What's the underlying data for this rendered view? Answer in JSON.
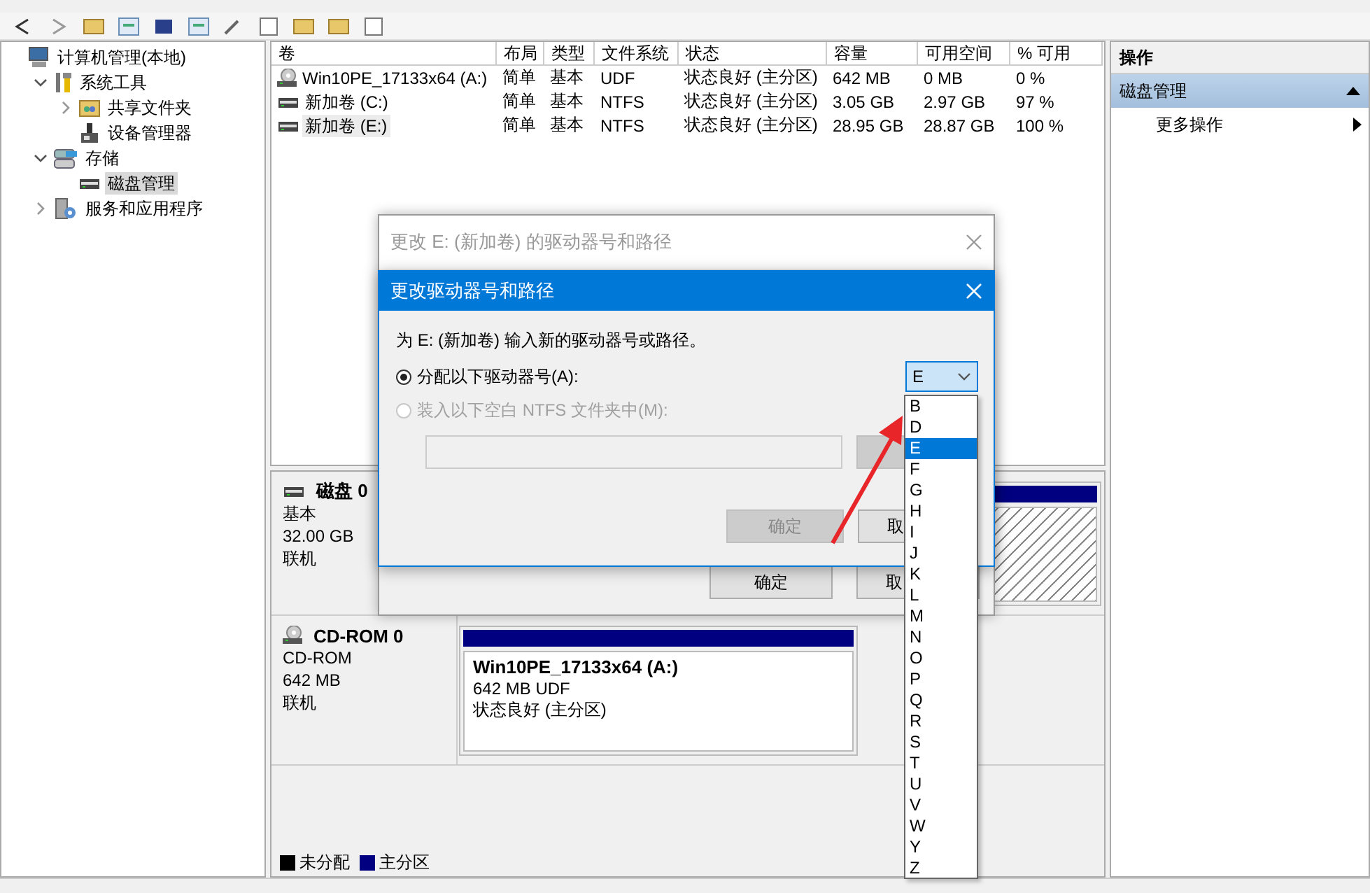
{
  "toolbar": [
    {
      "kind": "back"
    },
    {
      "kind": "forward"
    },
    {
      "kind": "folder"
    },
    {
      "kind": "grid"
    },
    {
      "kind": "box"
    },
    {
      "kind": "grid"
    },
    {
      "kind": "key"
    },
    {
      "kind": "page"
    },
    {
      "kind": "folder"
    },
    {
      "kind": "folder"
    },
    {
      "kind": "page"
    }
  ],
  "tree": [
    {
      "label": "计算机管理(本地)",
      "kind": "computer",
      "selected": false,
      "children": [
        {
          "label": "系统工具",
          "kind": "tools",
          "expanded": true,
          "selected": false,
          "children": [
            {
              "label": "共享文件夹",
              "kind": "share",
              "expanded": false,
              "selected": false
            },
            {
              "label": "设备管理器",
              "kind": "device",
              "selected": false
            }
          ]
        },
        {
          "label": "存储",
          "kind": "storage",
          "expanded": true,
          "selected": false,
          "children": [
            {
              "label": "磁盘管理",
              "kind": "disk",
              "selected": true
            }
          ]
        },
        {
          "label": "服务和应用程序",
          "kind": "services",
          "expanded": false,
          "selected": false
        }
      ]
    }
  ],
  "volumes": {
    "columns": [
      "卷",
      "布局",
      "类型",
      "文件系统",
      "状态",
      "容量",
      "可用空间",
      "% 可用"
    ],
    "rows": [
      {
        "kind": "cd",
        "selected": false,
        "cells": [
          "Win10PE_17133x64 (A:)",
          "简单",
          "基本",
          "UDF",
          "状态良好 (主分区)",
          "642 MB",
          "0 MB",
          "0 %"
        ]
      },
      {
        "kind": "disk",
        "selected": false,
        "cells": [
          "新加卷 (C:)",
          "简单",
          "基本",
          "NTFS",
          "状态良好 (主分区)",
          "3.05 GB",
          "2.97 GB",
          "97 %"
        ]
      },
      {
        "kind": "disk",
        "selected": true,
        "cells": [
          "新加卷 (E:)",
          "简单",
          "基本",
          "NTFS",
          "状态良好 (主分区)",
          "28.95 GB",
          "28.87 GB",
          "100 %"
        ]
      }
    ]
  },
  "disks": [
    {
      "kind": "disk",
      "name": "磁盘 0",
      "type": "基本",
      "size": "32.00 GB",
      "status": "联机",
      "partitions": [
        {
          "selected": true
        }
      ]
    },
    {
      "kind": "cd",
      "name": "CD-ROM 0",
      "type": "CD-ROM",
      "size": "642 MB",
      "status": "联机",
      "partitions": [
        {
          "selected": false,
          "name": "Win10PE_17133x64  (A:)",
          "detail": "642 MB UDF",
          "status": "状态良好 (主分区)"
        }
      ]
    }
  ],
  "legend": [
    {
      "label": "未分配",
      "color": "#000000"
    },
    {
      "label": "主分区",
      "color": "#000080"
    }
  ],
  "actions": {
    "title": "操作",
    "sections": [
      {
        "label": "磁盘管理",
        "expanded": true,
        "items": [
          {
            "label": "更多操作"
          }
        ]
      }
    ]
  },
  "back_dialog": {
    "title": "更改 E: (新加卷) 的驱动器号和路径",
    "buttons": [
      {
        "label": "确定",
        "disabled": false
      },
      {
        "label": "取",
        "disabled": false
      }
    ]
  },
  "dialog": {
    "title": "更改驱动器号和路径",
    "prompt": "为 E: (新加卷) 输入新的驱动器号或路径。",
    "options": [
      {
        "label": "分配以下驱动器号(A):",
        "selected": true,
        "disabled": false
      },
      {
        "label": "装入以下空白 NTFS 文件夹中(M):",
        "selected": false,
        "disabled": true
      }
    ],
    "drive_select": {
      "value": "E",
      "expanded": true
    },
    "browse_button": {
      "disabled": true
    },
    "buttons": [
      {
        "label": "确定",
        "disabled": true
      },
      {
        "label": "取",
        "disabled": false
      }
    ]
  },
  "dropdown": [
    {
      "label": "B",
      "selected": false
    },
    {
      "label": "D",
      "selected": false
    },
    {
      "label": "E",
      "selected": true
    },
    {
      "label": "F",
      "selected": false
    },
    {
      "label": "G",
      "selected": false
    },
    {
      "label": "H",
      "selected": false
    },
    {
      "label": "I",
      "selected": false
    },
    {
      "label": "J",
      "selected": false
    },
    {
      "label": "K",
      "selected": false
    },
    {
      "label": "L",
      "selected": false
    },
    {
      "label": "M",
      "selected": false
    },
    {
      "label": "N",
      "selected": false
    },
    {
      "label": "O",
      "selected": false
    },
    {
      "label": "P",
      "selected": false
    },
    {
      "label": "Q",
      "selected": false
    },
    {
      "label": "R",
      "selected": false
    },
    {
      "label": "S",
      "selected": false
    },
    {
      "label": "T",
      "selected": false
    },
    {
      "label": "U",
      "selected": false
    },
    {
      "label": "V",
      "selected": false
    },
    {
      "label": "W",
      "selected": false
    },
    {
      "label": "Y",
      "selected": false
    },
    {
      "label": "Z",
      "selected": false
    }
  ],
  "annotation": {
    "kind": "arrow"
  }
}
